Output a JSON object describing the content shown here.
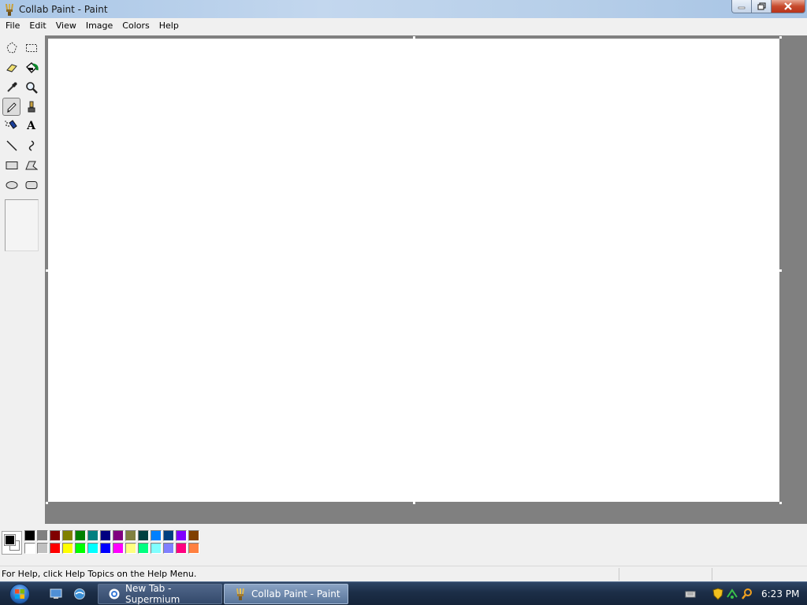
{
  "window": {
    "title": "Collab Paint - Paint"
  },
  "menu": {
    "items": [
      "File",
      "Edit",
      "View",
      "Image",
      "Colors",
      "Help"
    ]
  },
  "tools": [
    {
      "name": "free-form-select",
      "icon": "free-form-select-icon"
    },
    {
      "name": "select",
      "icon": "rect-select-icon"
    },
    {
      "name": "eraser",
      "icon": "eraser-icon"
    },
    {
      "name": "fill-with-color",
      "icon": "paint-bucket-icon"
    },
    {
      "name": "pick-color",
      "icon": "eyedropper-icon"
    },
    {
      "name": "magnifier",
      "icon": "magnifier-icon"
    },
    {
      "name": "pencil",
      "icon": "pencil-icon",
      "selected": true
    },
    {
      "name": "brush",
      "icon": "brush-icon"
    },
    {
      "name": "airbrush",
      "icon": "airbrush-icon"
    },
    {
      "name": "text",
      "icon": "text-icon",
      "glyph": "A"
    },
    {
      "name": "line",
      "icon": "line-icon"
    },
    {
      "name": "curve",
      "icon": "curve-icon"
    },
    {
      "name": "rectangle",
      "icon": "rectangle-icon"
    },
    {
      "name": "polygon",
      "icon": "polygon-icon"
    },
    {
      "name": "ellipse",
      "icon": "ellipse-icon"
    },
    {
      "name": "rounded-rectangle",
      "icon": "rounded-rect-icon"
    }
  ],
  "palette": {
    "foreground": "#000000",
    "background": "#ffffff",
    "top_row": [
      "#000000",
      "#808080",
      "#800000",
      "#808000",
      "#008000",
      "#008080",
      "#000080",
      "#800080",
      "#808040",
      "#004040",
      "#0080ff",
      "#004080",
      "#8000ff",
      "#804000"
    ],
    "bottom_row": [
      "#ffffff",
      "#c0c0c0",
      "#ff0000",
      "#ffff00",
      "#00ff00",
      "#00ffff",
      "#0000ff",
      "#ff00ff",
      "#ffff80",
      "#00ff80",
      "#80ffff",
      "#8080ff",
      "#ff0080",
      "#ff8040"
    ]
  },
  "status": {
    "text": "For Help, click Help Topics on the Help Menu."
  },
  "taskbar": {
    "tasks": [
      {
        "label": "New Tab - Supermium",
        "active": false
      },
      {
        "label": "Collab Paint - Paint",
        "active": true
      }
    ],
    "clock": "6:23 PM"
  }
}
